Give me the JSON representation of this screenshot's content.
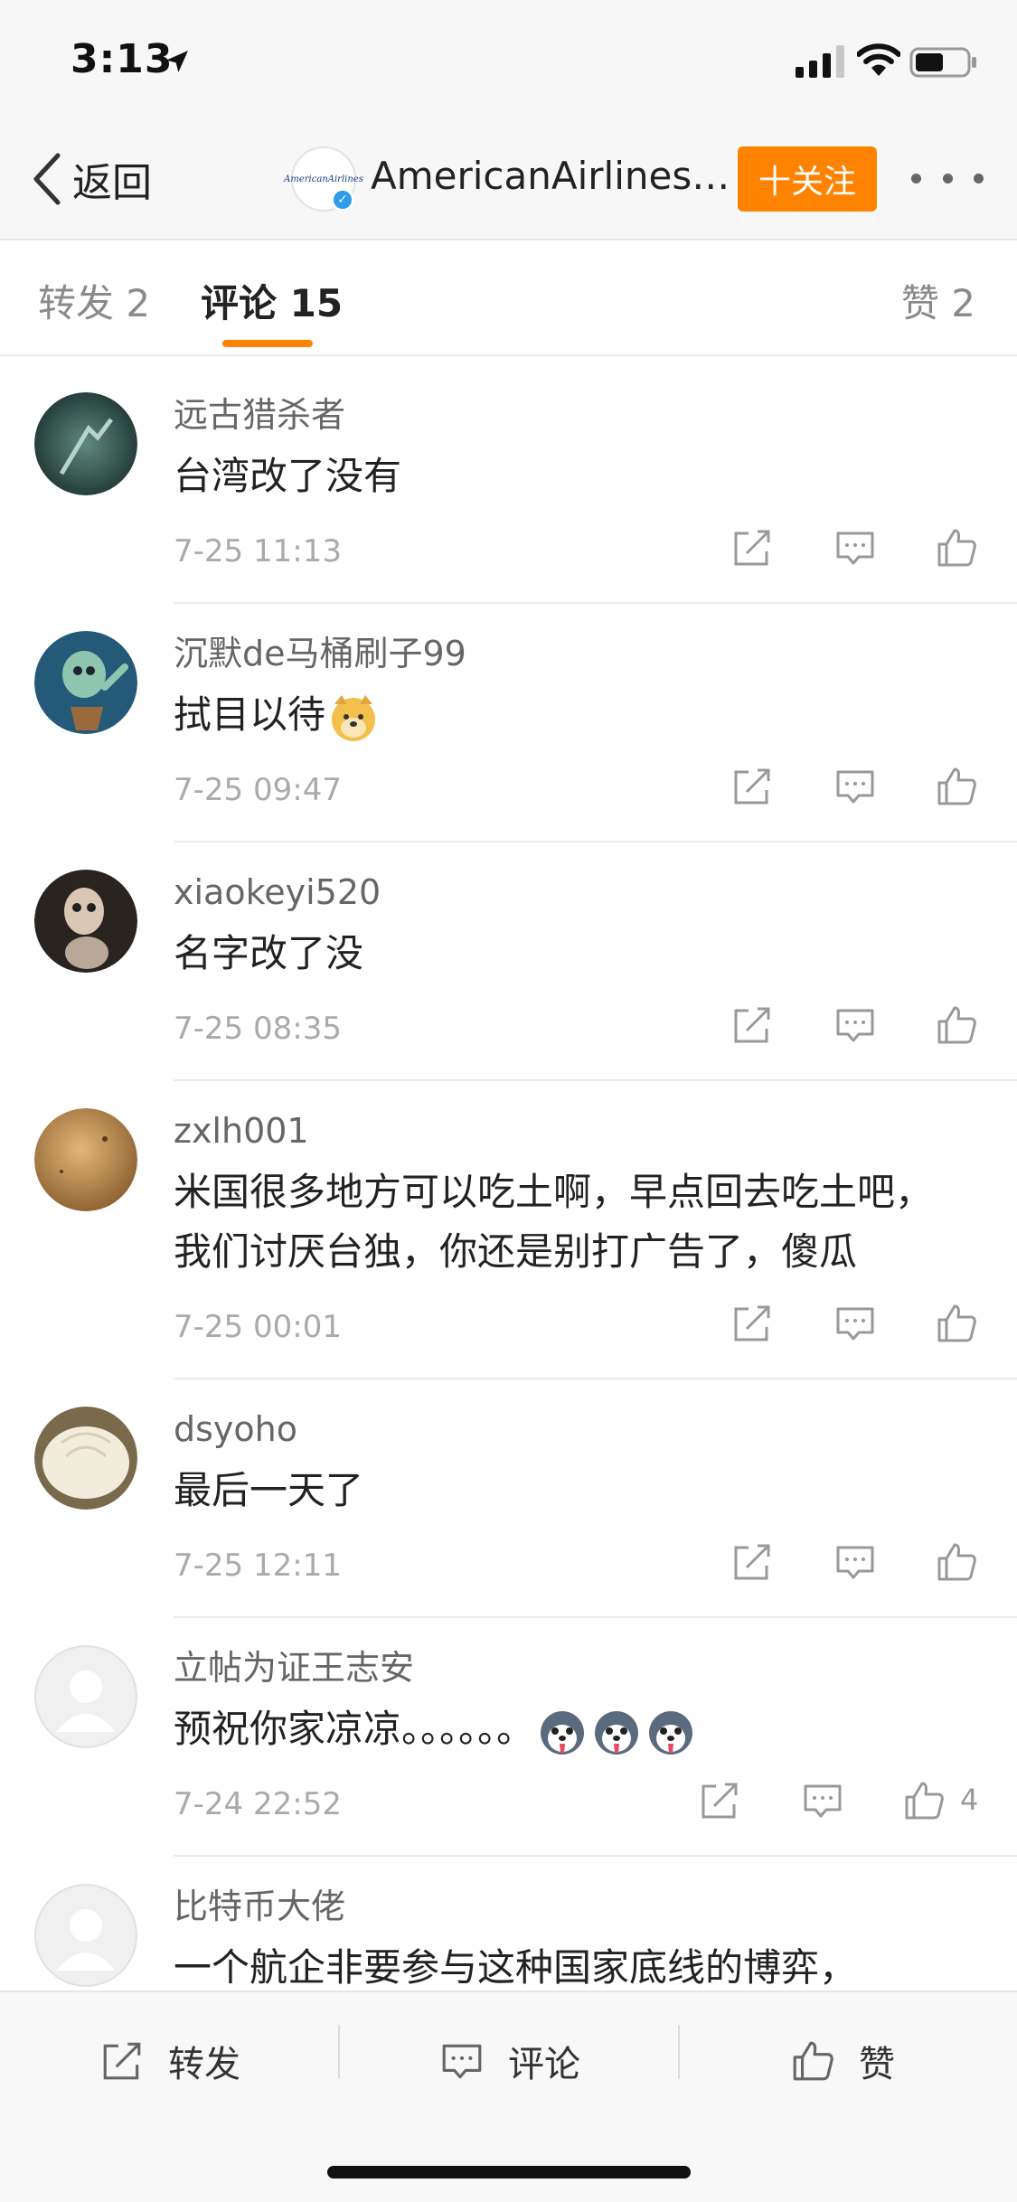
{
  "status_bar": {
    "time": "3:13"
  },
  "nav": {
    "back_label": "返回",
    "avatar_text": "AmericanAirlines",
    "title": "AmericanAirlines…",
    "follow_label": "十关注"
  },
  "tabs": {
    "repost": "转发 2",
    "comments": "评论 15",
    "likes": "赞 2"
  },
  "comments": [
    {
      "name": "远古猎杀者",
      "text": "台湾改了没有",
      "date": "7-25 11:13"
    },
    {
      "name": "沉默de马桶刷子99",
      "text": "拭目以待",
      "date": "7-25 09:47",
      "emoji": "doge"
    },
    {
      "name": "xiaokeyi520",
      "text": "名字改了没",
      "date": "7-25 08:35"
    },
    {
      "name": "zxlh001",
      "text": "米国很多地方可以吃土啊，早点回去吃土吧，我们讨厌台独，你还是别打广告了，傻瓜",
      "date": "7-25 00:01"
    },
    {
      "name": "dsyoho",
      "text": "最后一天了",
      "date": "7-25 12:11"
    },
    {
      "name": "立帖为证王志安",
      "text": "预祝你家凉凉。。。。。。",
      "date": "7-24 22:52",
      "likes": "4",
      "emoji": "husky"
    },
    {
      "name": "比特币大佬",
      "text": "一个航企非要参与这种国家底线的博弈，",
      "date": ""
    }
  ],
  "bottom_bar": {
    "repost": "转发",
    "comment": "评论",
    "like": "赞"
  },
  "colors": {
    "accent": "#ff8200",
    "verified": "#2b9bea"
  }
}
